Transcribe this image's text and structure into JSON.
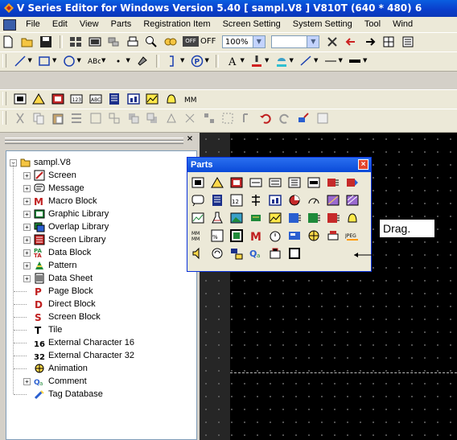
{
  "window": {
    "title": "V Series Editor for Windows Version 5.40 [ sampl.V8 ] V810T (640 * 480) 6"
  },
  "menubar": {
    "items": [
      "File",
      "Edit",
      "View",
      "Parts",
      "Registration Item",
      "Screen Setting",
      "System Setting",
      "Tool",
      "Wind"
    ]
  },
  "toolbar1": {
    "off_label": "OFF",
    "zoom_value": "100%"
  },
  "tree": {
    "root": "sampl.V8",
    "items": [
      "Screen",
      "Message",
      "Macro Block",
      "Graphic Library",
      "Overlap Library",
      "Screen Library",
      "Data Block",
      "Pattern",
      "Data Sheet",
      "Page Block",
      "Direct Block",
      "Screen Block",
      "Tile",
      "External Character 16",
      "External Character 32",
      "Animation",
      "Comment",
      "Tag Database"
    ]
  },
  "parts_window": {
    "title": "Parts"
  },
  "annotation": {
    "drag_label": "Drag."
  },
  "colors": {
    "titlebar": "#0a46d6",
    "canvas": "#000000",
    "panel": "#d4d0c8"
  }
}
